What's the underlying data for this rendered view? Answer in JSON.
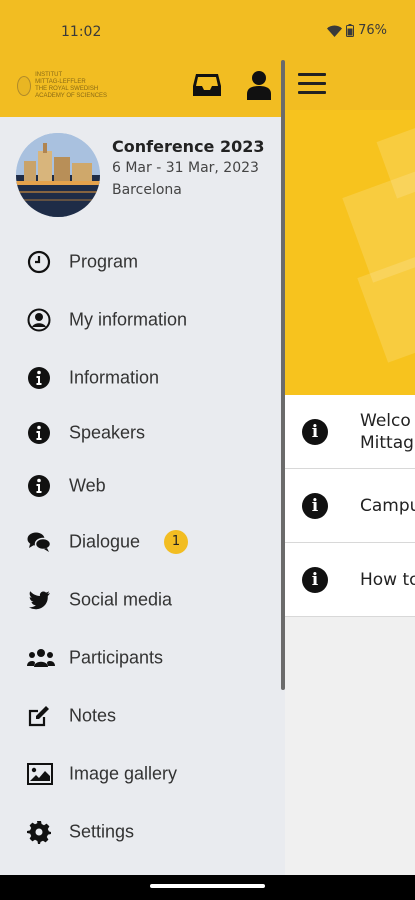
{
  "status": {
    "time": "11:02",
    "battery": "76%"
  },
  "drawer": {
    "conference": {
      "title": "Conference 2023",
      "dates": "6 Mar - 31 Mar, 2023",
      "place": "Barcelona"
    },
    "menu": [
      {
        "label": "Program",
        "icon": "clock-icon"
      },
      {
        "label": "My information",
        "icon": "user-circle-icon"
      },
      {
        "label": "Information",
        "icon": "info-icon"
      },
      {
        "label": "Speakers",
        "icon": "info-icon"
      },
      {
        "label": "Web",
        "icon": "info-icon"
      },
      {
        "label": "Dialogue",
        "icon": "chat-icon",
        "badge": "1"
      },
      {
        "label": "Social media",
        "icon": "twitter-icon"
      },
      {
        "label": "Participants",
        "icon": "users-icon"
      },
      {
        "label": "Notes",
        "icon": "edit-icon"
      },
      {
        "label": "Image gallery",
        "icon": "image-icon"
      },
      {
        "label": "Settings",
        "icon": "gear-icon"
      }
    ]
  },
  "main": {
    "list": [
      {
        "line1": "Welco",
        "line2": "Mittag"
      },
      {
        "line1": "Campu"
      },
      {
        "line1": "How to"
      }
    ]
  },
  "colors": {
    "accent": "#f2bd22",
    "drawer_bg": "#e9ebef"
  }
}
